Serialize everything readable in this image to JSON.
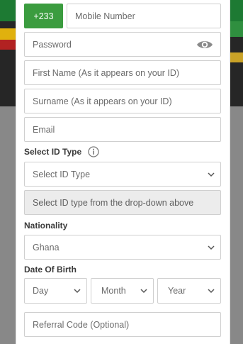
{
  "phone": {
    "country_code": "+233",
    "placeholder": "Mobile Number"
  },
  "password": {
    "placeholder": "Password",
    "toggle_icon": "eye-icon"
  },
  "first_name": {
    "placeholder": "First Name (As it appears on your ID)"
  },
  "surname": {
    "placeholder": "Surname (As it appears on your ID)"
  },
  "email": {
    "placeholder": "Email"
  },
  "id_type": {
    "label": "Select ID Type",
    "info_icon": "info-icon",
    "selected": "Select ID Type",
    "id_number_placeholder": "Select ID type from the drop-down above"
  },
  "nationality": {
    "label": "Nationality",
    "selected": "Ghana"
  },
  "dob": {
    "label": "Date Of Birth",
    "day": "Day",
    "month": "Month",
    "year": "Year"
  },
  "referral": {
    "placeholder": "Referral Code (Optional)"
  },
  "colors": {
    "accent_green": "#3b9c3f",
    "border": "#cfcfcf",
    "disabled_bg": "#ececec"
  }
}
